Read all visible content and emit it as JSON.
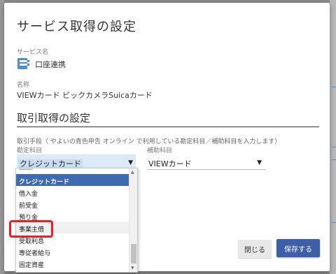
{
  "modal": {
    "title": "サービス取得の設定"
  },
  "service": {
    "label": "サービス名",
    "name": "口座連携"
  },
  "card": {
    "label": "名称",
    "name": "VIEWカード ビックカメラSuicaカード"
  },
  "section": {
    "title": "取引取得の設定",
    "hint": "取引手段（ やよいの青色申告 オンライン で利用している勘定科目／補助科目を入力します）",
    "account_label": "勘定科目",
    "sub_label": "補助科目",
    "account_value": "クレジットカード",
    "sub_value": "VIEWカード"
  },
  "dropdown": {
    "cut_text": "━━━━",
    "items": [
      {
        "label": "クレジットカード",
        "state": "selected"
      },
      {
        "label": "借入金",
        "state": "normal"
      },
      {
        "label": "前受金",
        "state": "normal"
      },
      {
        "label": "預り金",
        "state": "normal"
      },
      {
        "label": "事業主借",
        "state": "hover"
      },
      {
        "label": "受取利息",
        "state": "normal"
      },
      {
        "label": "専従者給与",
        "state": "normal"
      },
      {
        "label": "固定資産",
        "state": "normal"
      }
    ]
  },
  "buttons": {
    "close": "閉じる",
    "save": "保存する"
  },
  "colors": {
    "primary": "#3e5ea8",
    "selected_item": "#3e6bb0",
    "highlight": "#e8202a"
  }
}
